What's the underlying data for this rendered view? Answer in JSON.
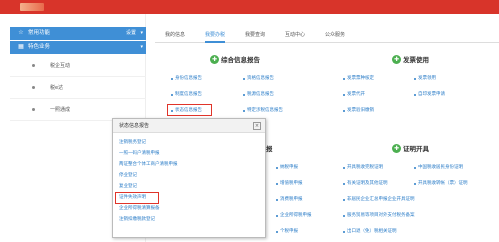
{
  "header": {
    "logo_alt": "税务"
  },
  "sidebar": {
    "sections": [
      {
        "label": "常用功能",
        "action": "设置"
      },
      {
        "label": "特色业务"
      }
    ],
    "items": [
      {
        "label": "税企互动"
      },
      {
        "label": "税e达"
      },
      {
        "label": "一照通成"
      }
    ]
  },
  "tabs": [
    {
      "label": "我的信息"
    },
    {
      "label": "我要办税"
    },
    {
      "label": "我要查询"
    },
    {
      "label": "互动中心"
    },
    {
      "label": "公众服务"
    }
  ],
  "sections": {
    "comprehensive": {
      "title": "综合信息报告",
      "links": [
        {
          "label": "身份信息报告"
        },
        {
          "label": "资格信息报告"
        },
        {
          "label": "制度信息报告"
        },
        {
          "label": "税源信息报告"
        },
        {
          "label": "状态信息报告"
        },
        {
          "label": "特定涉税信息报告"
        }
      ]
    },
    "invoice": {
      "title": "发票使用",
      "links": [
        {
          "label": "发票票种核定"
        },
        {
          "label": "发票领用"
        },
        {
          "label": "发票代开"
        },
        {
          "label": "自印发票申请"
        },
        {
          "label": "发票验旧缴销"
        }
      ]
    },
    "certificate": {
      "title": "证明开具",
      "links": [
        {
          "label": "开具税收完税证明"
        },
        {
          "label": "中国税收居民身份证明"
        },
        {
          "label": "有关证明及其他证明"
        },
        {
          "label": "开具税收转帐（票）证明"
        },
        {
          "label": "非居民企业汇总申报企业开具证明"
        },
        {
          "label": "服务贸易等项目对外支付税务备案"
        },
        {
          "label": "出口退（免）税相关证明"
        }
      ]
    },
    "hidden_column": {
      "title": "报",
      "links": [
        {
          "label": "纳税申报"
        },
        {
          "label": "增值税申报"
        },
        {
          "label": "消费税申报"
        },
        {
          "label": "企业所得税申报"
        },
        {
          "label": "个税申报"
        }
      ]
    }
  },
  "popup": {
    "title": "状态信息报告",
    "close": "×",
    "links": [
      {
        "label": "注销税务登记"
      },
      {
        "label": "一照一码户清税申报"
      },
      {
        "label": "两证整合个体工商户清税申报"
      },
      {
        "label": "停业登记"
      },
      {
        "label": "复业登记"
      },
      {
        "label": "证件失效声明"
      },
      {
        "label": "企业所得税清算报备"
      },
      {
        "label": "注销扣缴税款登记"
      }
    ]
  }
}
